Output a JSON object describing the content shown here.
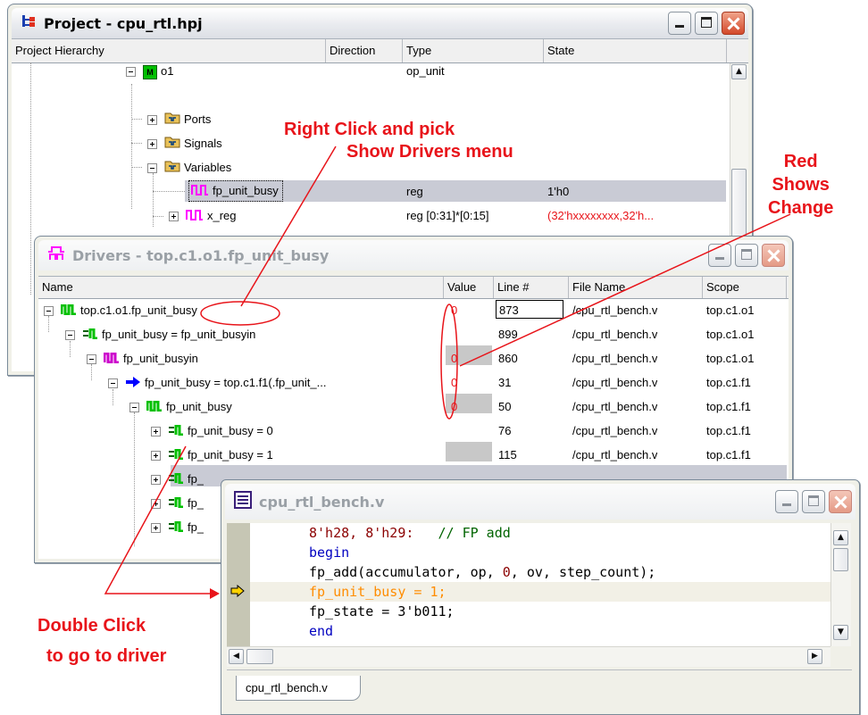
{
  "project_window": {
    "title": "Project - cpu_rtl.hpj",
    "columns": {
      "hierarchy": "Project Hierarchy",
      "direction": "Direction",
      "type": "Type",
      "state": "State"
    },
    "rows": [
      {
        "label": "o1",
        "type": "op_unit",
        "state": ""
      },
      {
        "label": "Ports",
        "type": "",
        "state": ""
      },
      {
        "label": "Signals",
        "type": "",
        "state": ""
      },
      {
        "label": "Variables",
        "type": "",
        "state": ""
      },
      {
        "label": "fp_unit_busy",
        "type": "reg",
        "state": "1'h0"
      },
      {
        "label": "x_reg",
        "type": "reg [0:31]*[0:15]",
        "state": "(32'hxxxxxxxx,32'h..."
      }
    ],
    "module_badge": "M"
  },
  "drivers_window": {
    "title": "Drivers - top.c1.o1.fp_unit_busy",
    "columns": {
      "name": "Name",
      "value": "Value",
      "line": "Line #",
      "file": "File Name",
      "scope": "Scope"
    },
    "rows": [
      {
        "name": "top.c1.o1.fp_unit_busy",
        "value": "0",
        "line": "873",
        "file": "/cpu_rtl_bench.v",
        "scope": "top.c1.o1"
      },
      {
        "name": "fp_unit_busy = fp_unit_busyin",
        "value": "",
        "line": "899",
        "file": "/cpu_rtl_bench.v",
        "scope": "top.c1.o1"
      },
      {
        "name": "fp_unit_busyin",
        "value": "0",
        "line": "860",
        "file": "/cpu_rtl_bench.v",
        "scope": "top.c1.o1"
      },
      {
        "name": "fp_unit_busy = top.c1.f1(.fp_unit_...",
        "value": "0",
        "line": "31",
        "file": "/cpu_rtl_bench.v",
        "scope": "top.c1.f1"
      },
      {
        "name": "fp_unit_busy",
        "value": "0",
        "line": "50",
        "file": "/cpu_rtl_bench.v",
        "scope": "top.c1.f1"
      },
      {
        "name": "fp_unit_busy = 0",
        "value": "",
        "line": "76",
        "file": "/cpu_rtl_bench.v",
        "scope": "top.c1.f1"
      },
      {
        "name": "fp_unit_busy = 1",
        "value": "",
        "line": "115",
        "file": "/cpu_rtl_bench.v",
        "scope": "top.c1.f1"
      },
      {
        "name": "fp_",
        "value": "",
        "line": "",
        "file": "",
        "scope": ""
      },
      {
        "name": "fp_",
        "value": "",
        "line": "",
        "file": "",
        "scope": ""
      },
      {
        "name": "fp_",
        "value": "",
        "line": "",
        "file": "",
        "scope": ""
      }
    ]
  },
  "editor_window": {
    "title": "cpu_rtl_bench.v",
    "tab_label": "cpu_rtl_bench.v",
    "code": {
      "l1_a": "8'h28, 8'h29:",
      "l1_b": "   // FP add",
      "l2": "begin",
      "l3_a": "fp_add(accumulator, op, ",
      "l3_b": "0",
      "l3_c": ", ov, step_count);",
      "l4": "fp_unit_busy = 1;",
      "l5": "fp_state = 3'b011;",
      "l6": "end"
    }
  },
  "annotations": {
    "right_click_1": "Right Click and pick",
    "right_click_2": "Show Drivers menu",
    "red_shows_1": "Red",
    "red_shows_2": "Shows",
    "red_shows_3": "Change",
    "double_click_1": "Double Click",
    "double_click_2": "to go to driver"
  },
  "colors": {
    "annotation_red": "#e8141a",
    "code_dark_red": "#8b0000",
    "code_green": "#006400",
    "code_blue": "#0000c0",
    "code_orange": "#ff8c00",
    "icon_magenta": "#ff00ff",
    "icon_green": "#00c000"
  }
}
